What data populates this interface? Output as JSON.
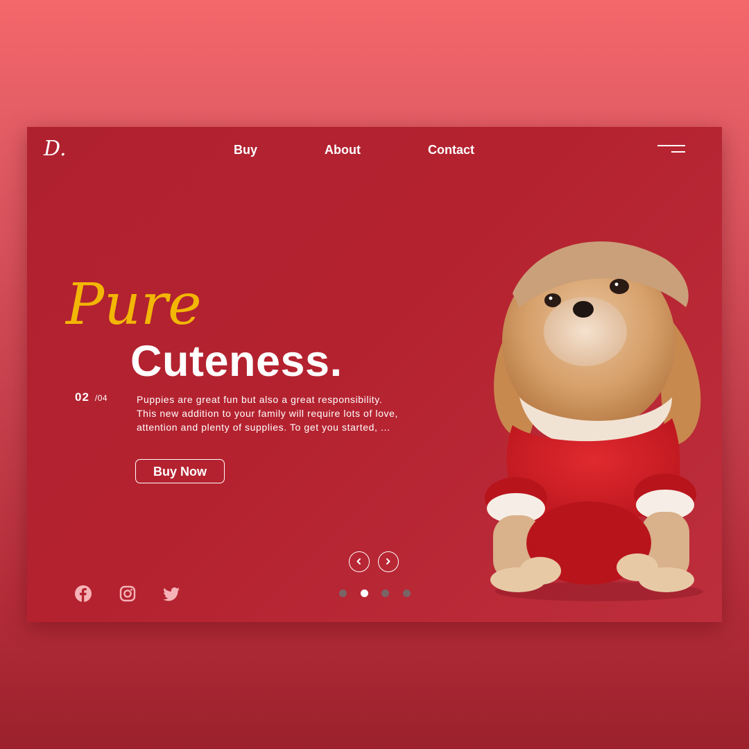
{
  "logo": {
    "text": "D."
  },
  "nav": {
    "items": [
      {
        "label": "Buy"
      },
      {
        "label": "About"
      },
      {
        "label": "Contact"
      }
    ]
  },
  "hero": {
    "script_title": "Pure",
    "main_title": "Cuteness.",
    "slide_current": "02",
    "slide_total": "/04",
    "description": "Puppies are great fun but also a great responsibility. This new addition to your family will require lots of love, attention and plenty of supplies. To get you started, ...",
    "cta_label": "Buy Now"
  },
  "carousel": {
    "current_slide": 2,
    "total_slides": 4,
    "prev_icon": "chevron-left-icon",
    "next_icon": "chevron-right-icon"
  },
  "social": [
    "facebook-icon",
    "instagram-icon",
    "twitter-icon"
  ],
  "colors": {
    "background": "#f4676b",
    "card": "#b4222f",
    "accent_script": "#f2b705",
    "text": "#ffffff",
    "dot_inactive": "#7a6466",
    "social_icon": "#f6b3b7"
  }
}
